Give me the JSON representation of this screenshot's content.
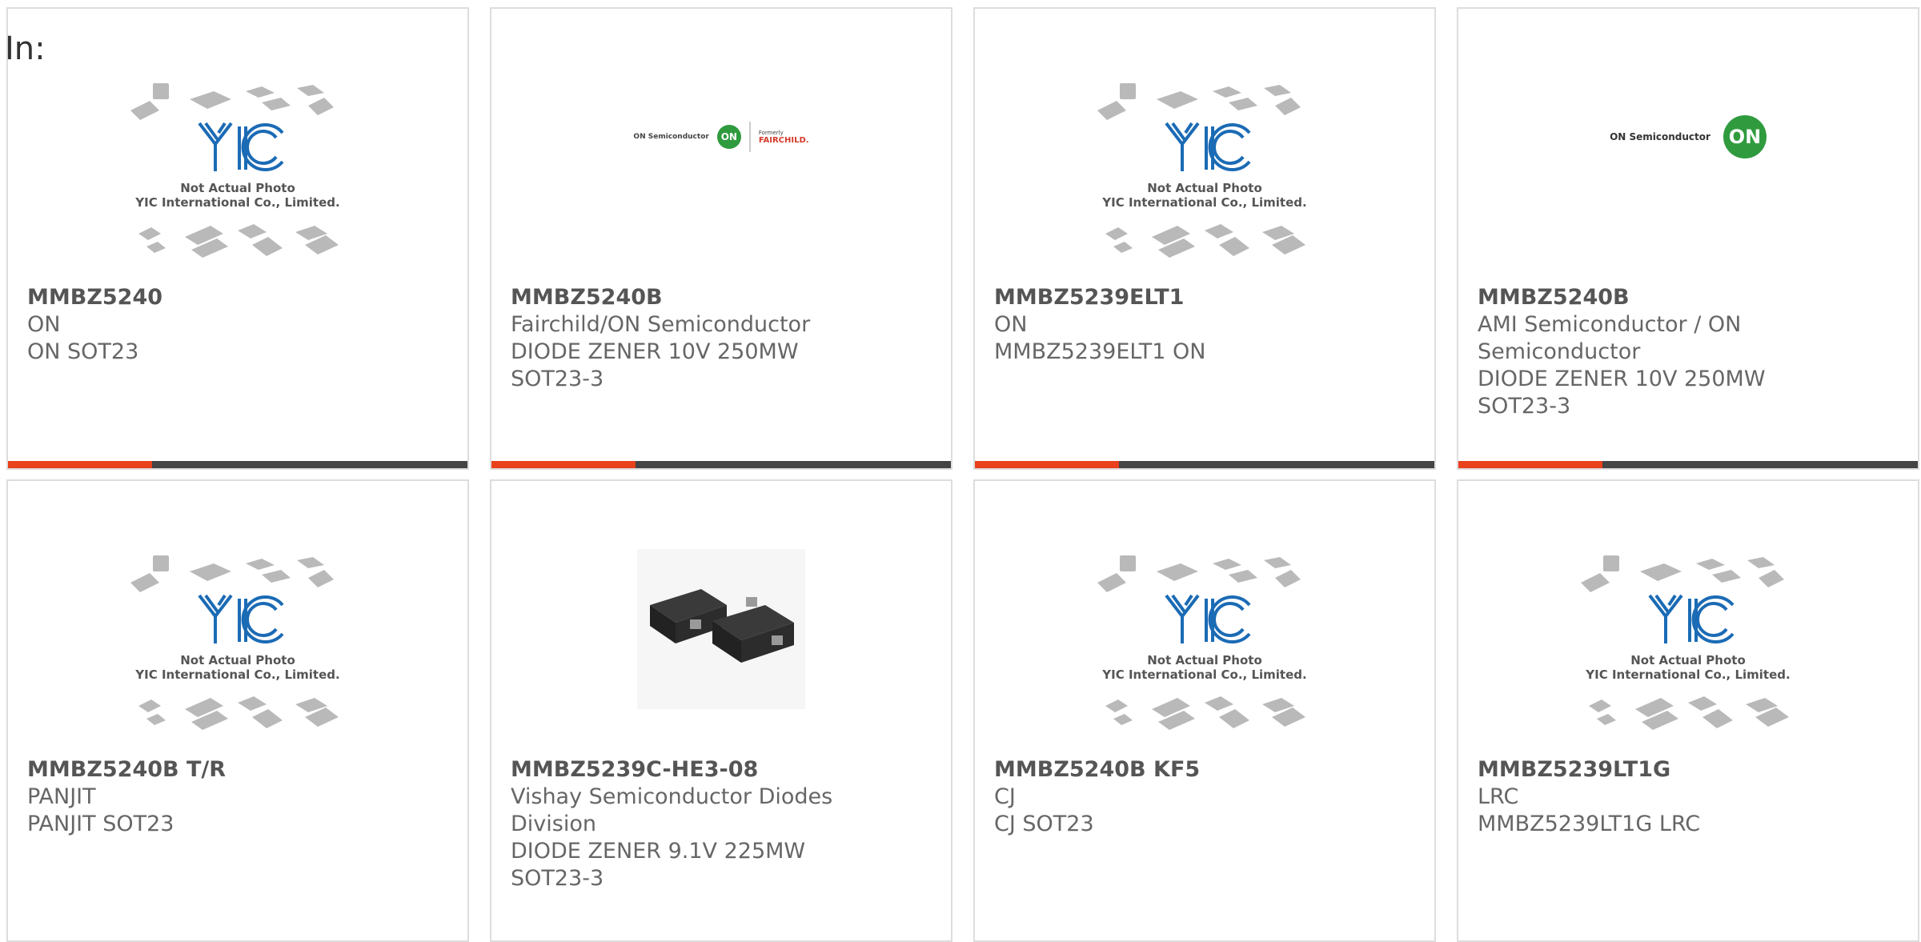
{
  "header": {
    "label": "In:"
  },
  "placeholder_photo": {
    "line1": "Not Actual Photo",
    "line2": "YIC International Co., Limited.",
    "logo": "YIC"
  },
  "logos": {
    "on_semiconductor": "ON Semiconductor",
    "on_badge": "ON",
    "fairchild_formerly": "Formerly",
    "fairchild": "FAIRCHILD."
  },
  "accent_color": "#e8411c",
  "bar_color": "#444444",
  "products": [
    {
      "part": "MMBZ5240",
      "lines": [
        "ON",
        "ON SOT23"
      ]
    },
    {
      "part": "MMBZ5240B",
      "lines": [
        "Fairchild/ON Semiconductor",
        "DIODE ZENER 10V 250MW",
        "SOT23-3"
      ]
    },
    {
      "part": "MMBZ5239ELT1",
      "lines": [
        "ON",
        "MMBZ5239ELT1 ON"
      ]
    },
    {
      "part": "MMBZ5240B",
      "lines": [
        "AMI Semiconductor / ON",
        "Semiconductor",
        "DIODE ZENER 10V 250MW",
        "SOT23-3"
      ]
    },
    {
      "part": "MMBZ5240B T/R",
      "lines": [
        "PANJIT",
        "PANJIT SOT23"
      ]
    },
    {
      "part": "MMBZ5239C-HE3-08",
      "lines": [
        "Vishay Semiconductor Diodes",
        "Division",
        "DIODE ZENER 9.1V 225MW",
        "SOT23-3"
      ]
    },
    {
      "part": "MMBZ5240B KF5",
      "lines": [
        "CJ",
        "CJ SOT23"
      ]
    },
    {
      "part": "MMBZ5239LT1G",
      "lines": [
        "LRC",
        "MMBZ5239LT1G LRC"
      ]
    }
  ]
}
